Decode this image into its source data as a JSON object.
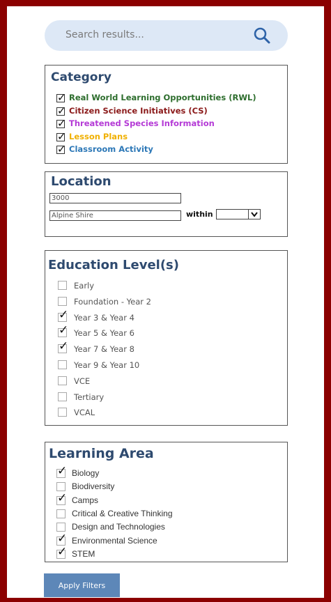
{
  "search": {
    "placeholder": "Search results..."
  },
  "category": {
    "title": "Category",
    "items": [
      {
        "label": "Real World Learning Opportunities (RWL)",
        "checked": true,
        "color": "#2e6e2e"
      },
      {
        "label": "Citizen Science Initiatives (CS)",
        "checked": true,
        "color": "#8b1a1a"
      },
      {
        "label": "Threatened Species Information",
        "checked": true,
        "color": "#b43ad6"
      },
      {
        "label": "Lesson Plans",
        "checked": true,
        "color": "#f0b000"
      },
      {
        "label": "Classroom Activity",
        "checked": true,
        "color": "#2d78b7"
      }
    ]
  },
  "location": {
    "title": "Location",
    "postcode_value": "3000",
    "shire_value": "Alpine Shire",
    "within_label": "within",
    "within_value": ""
  },
  "education": {
    "title": "Education Level(s)",
    "items": [
      {
        "label": "Early",
        "checked": false
      },
      {
        "label": "Foundation - Year 2",
        "checked": false
      },
      {
        "label": "Year 3 & Year 4",
        "checked": true
      },
      {
        "label": "Year 5 & Year 6",
        "checked": true
      },
      {
        "label": "Year 7 & Year 8",
        "checked": true
      },
      {
        "label": "Year 9 & Year 10",
        "checked": false
      },
      {
        "label": "VCE",
        "checked": false
      },
      {
        "label": "Tertiary",
        "checked": false
      },
      {
        "label": "VCAL",
        "checked": false
      }
    ]
  },
  "learning_area": {
    "title": "Learning Area",
    "items": [
      {
        "label": "Biology",
        "checked": true
      },
      {
        "label": "Biodiversity",
        "checked": false
      },
      {
        "label": "Camps",
        "checked": true
      },
      {
        "label": "Critical & Creative Thinking",
        "checked": false
      },
      {
        "label": "Design and Technologies",
        "checked": false
      },
      {
        "label": "Environmental Science",
        "checked": true
      },
      {
        "label": "STEM",
        "checked": true
      }
    ]
  },
  "apply_label": "Apply Filters",
  "colors": {
    "frame": "#8b0000",
    "title": "#2e4a6f",
    "button": "#5d87b8",
    "search_bg": "#dde8f6"
  }
}
